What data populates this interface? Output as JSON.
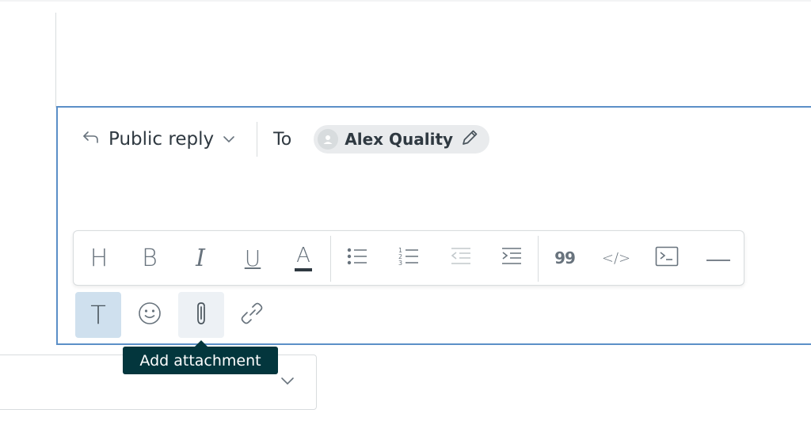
{
  "reply": {
    "type_label": "Public reply",
    "to_label": "To"
  },
  "recipient": {
    "name": "Alex Quality"
  },
  "format_toolbar": {
    "heading_glyph": "H",
    "bold_glyph": "B",
    "italic_glyph": "I",
    "underline_glyph": "U",
    "text_color_glyph": "A",
    "blockquote_glyph": "99",
    "code_glyph": "</>"
  },
  "bottom_toolbar": {
    "text_format_glyph": "T"
  },
  "tooltip": {
    "text": "Add attachment"
  },
  "colors": {
    "accent": "#5b8fc7",
    "tooltip_bg": "#03363d",
    "active_bg": "#cfe0ee"
  }
}
